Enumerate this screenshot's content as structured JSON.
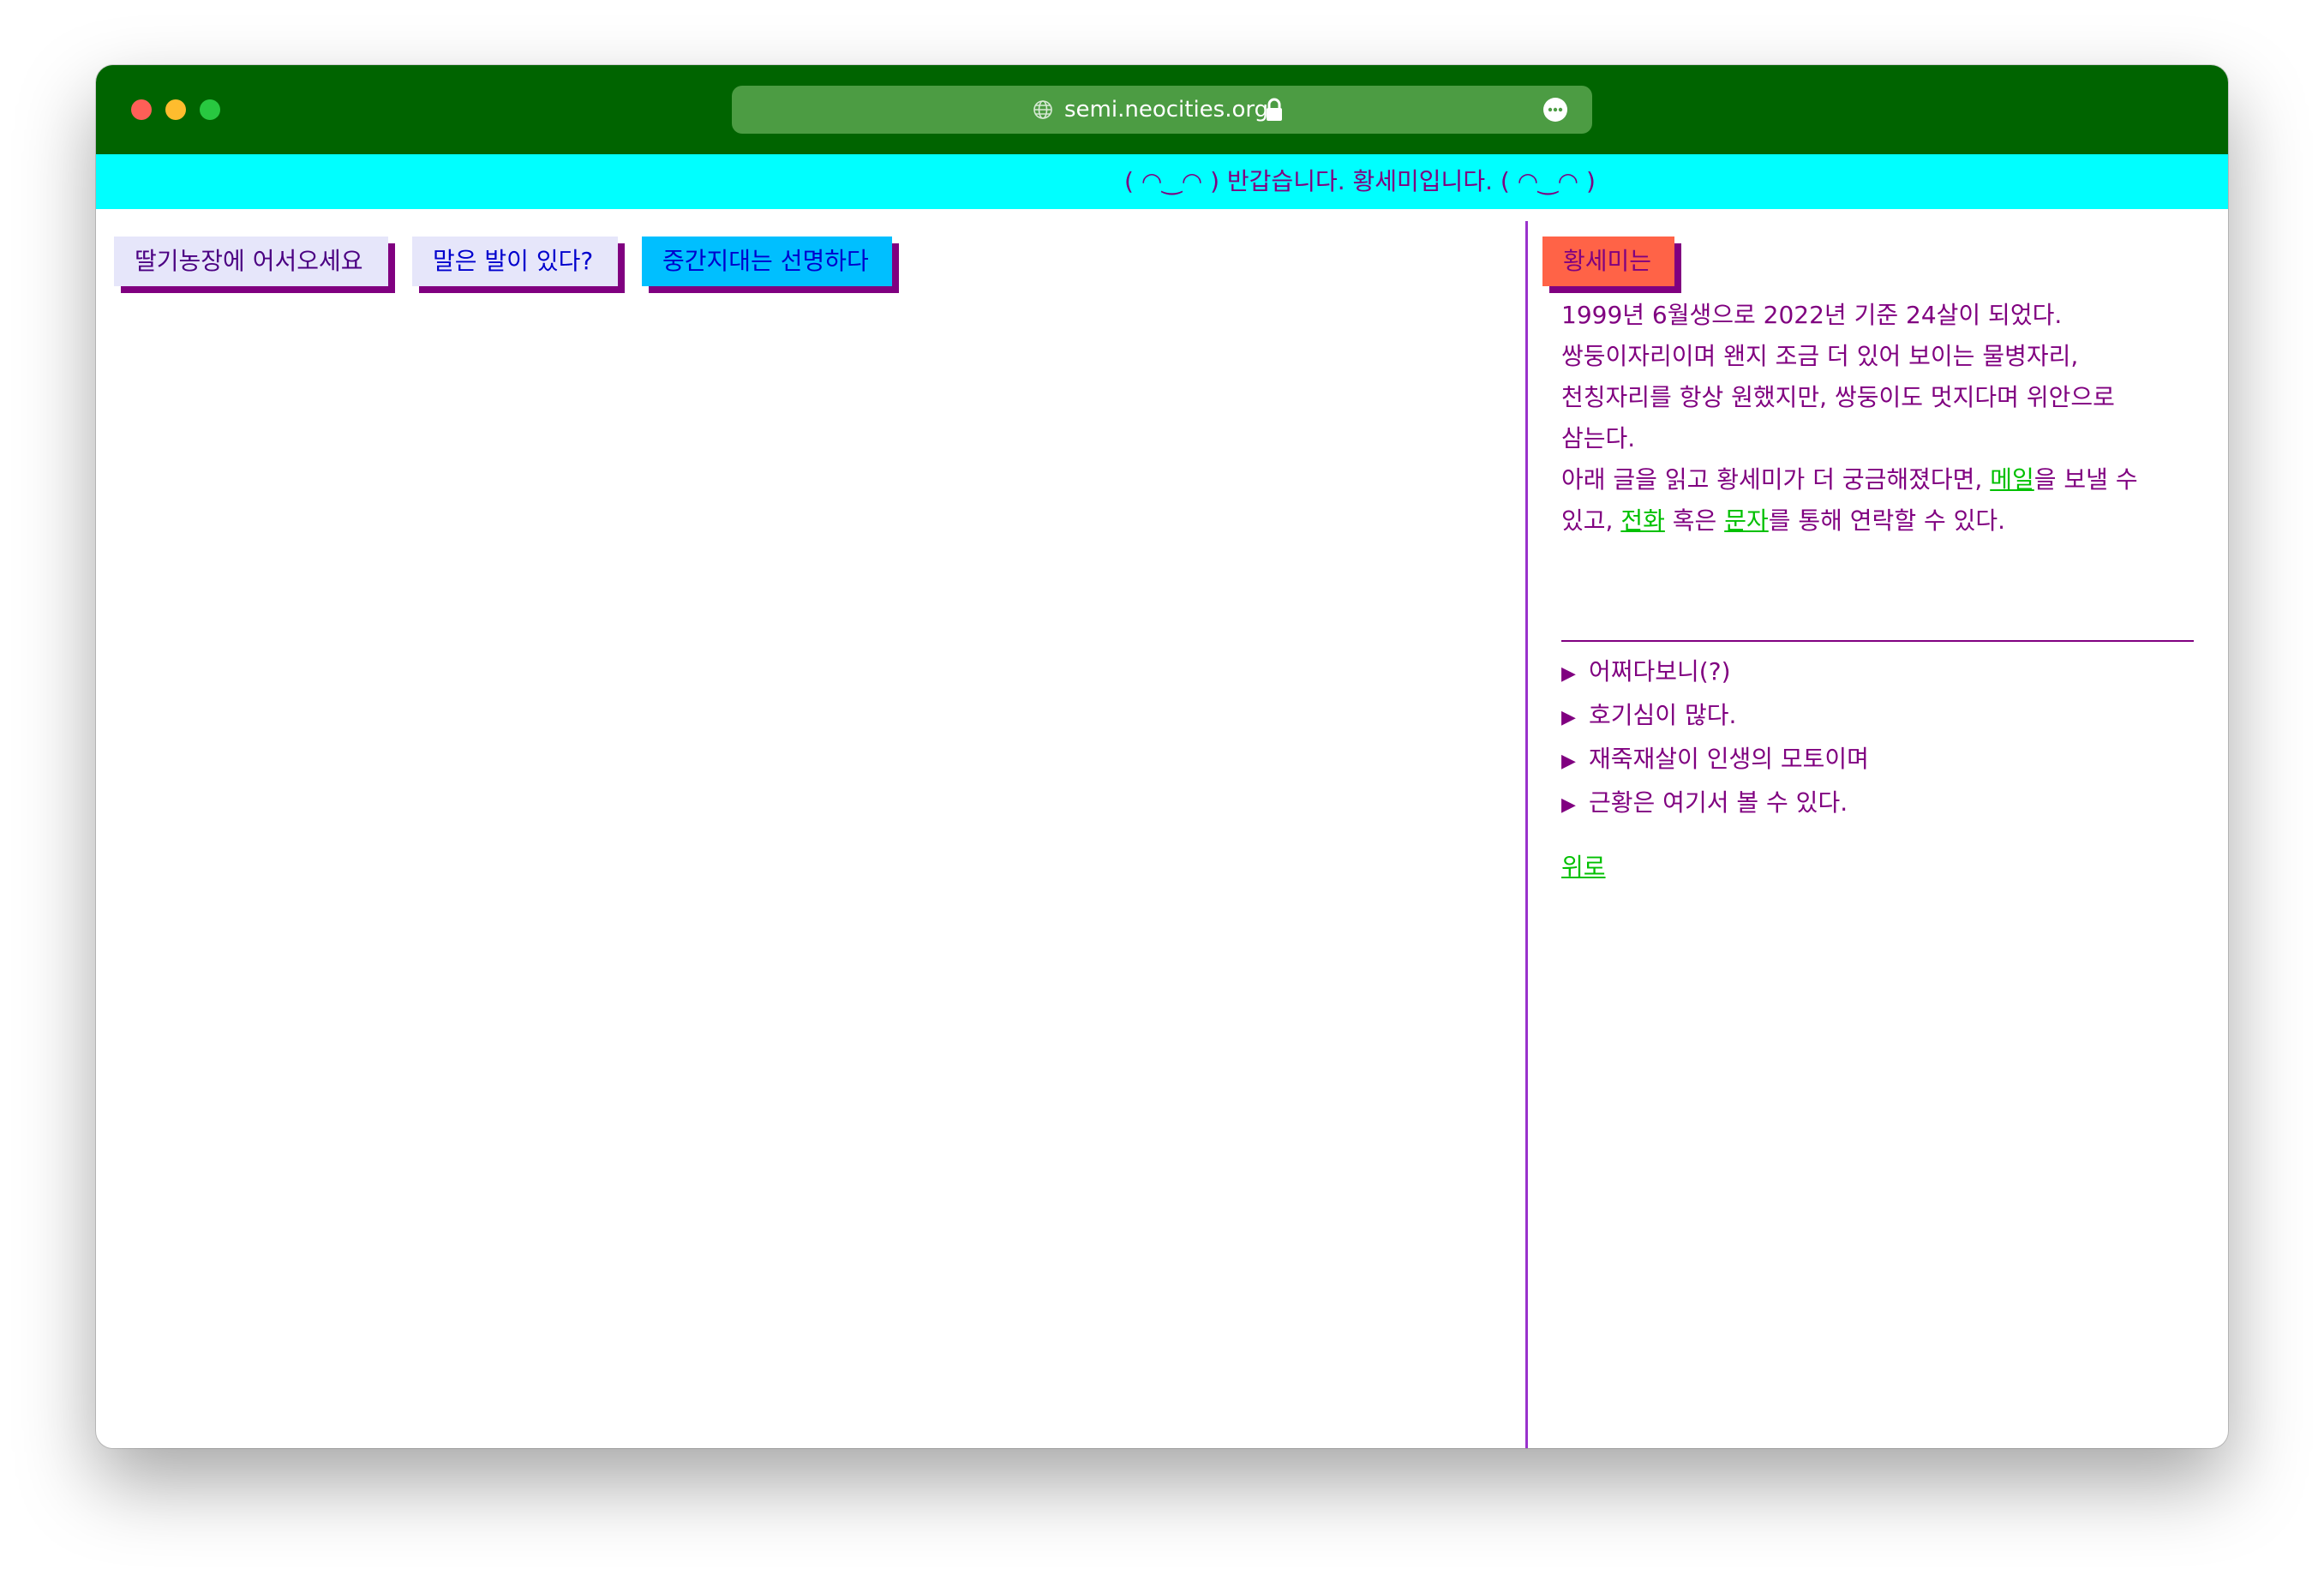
{
  "browser": {
    "url": "semi.neocities.org"
  },
  "banner": {
    "text": "( ◠‿◠ ) 반갑습니다. 황세미입니다. ( ◠‿◠ )"
  },
  "tabs": [
    {
      "label": "딸기농장에 어서오세요"
    },
    {
      "label": "말은 발이 있다?"
    },
    {
      "label": "중간지대는 선명하다"
    }
  ],
  "sidebar": {
    "button_label": "황세미는",
    "about_lines": [
      "1999년 6월생으로 2022년 기준 24살이 되었다.",
      "쌍둥이자리이며 왠지 조금 더 있어 보이는 물병자리,",
      "천칭자리를 항상 원했지만, 쌍둥이도 멋지다며 위안으로",
      "삼는다."
    ],
    "contact": {
      "part1": "아래 글을 읽고 황세미가 더 궁금해졌다면, ",
      "mail_link": "메일",
      "part2": "을 보낼 수",
      "part3": "있고, ",
      "phone_link": "전화",
      "part4": " 혹은 ",
      "text_link": "문자",
      "part5": "를 통해 연락할 수 있다."
    },
    "items": [
      {
        "label": "어쩌다보니(?)"
      },
      {
        "label": "호기심이 많다."
      },
      {
        "label": "재죽재살이 인생의 모토이며"
      },
      {
        "label": "근황은 여기서 볼 수 있다."
      }
    ],
    "up_link": "위로"
  },
  "colors": {
    "titlebar": "#006400",
    "banner": "#00ffff",
    "text": "#800080",
    "link": "#00c000"
  }
}
